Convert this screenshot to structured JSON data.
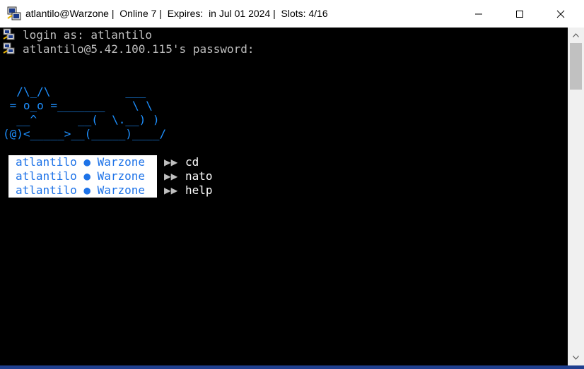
{
  "window": {
    "title": "atlantilo@Warzone |  Online 7 |  Expires:  in Jul 01 2024 |  Slots: 4/16",
    "app_icon": "putty-icon"
  },
  "terminal": {
    "lines": [
      {
        "text": "login as: atlantilo",
        "icon": "key-icon"
      },
      {
        "text": "atlantilo@5.42.100.115's password:",
        "icon": "key-icon"
      }
    ],
    "ascii_art": [
      "  /\\_/\\           ___",
      " = o_o =_______    \\ \\",
      "  __^      __(  \\.__) )",
      "(@)<_____>__(_____)____/"
    ],
    "prompts": [
      {
        "label": "atlantilo ● Warzone",
        "arrows": "▶▶",
        "command": "cd"
      },
      {
        "label": "atlantilo ● Warzone",
        "arrows": "▶▶",
        "command": "nato"
      },
      {
        "label": "atlantilo ● Warzone",
        "arrows": "▶▶",
        "command": "help"
      }
    ]
  },
  "colors": {
    "terminal_bg": "#000000",
    "ascii_art": "#1e90ff",
    "prompt_label": "#1e73e8",
    "prompt_bg": "#ffffff"
  }
}
